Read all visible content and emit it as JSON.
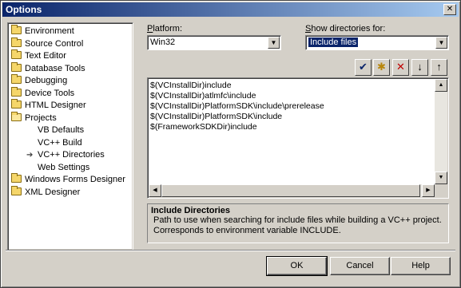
{
  "window": {
    "title": "Options",
    "close_glyph": "✕"
  },
  "tree": {
    "items": [
      {
        "label": "Environment",
        "icon": "folder-icon"
      },
      {
        "label": "Source Control",
        "icon": "folder-icon"
      },
      {
        "label": "Text Editor",
        "icon": "folder-icon"
      },
      {
        "label": "Database Tools",
        "icon": "folder-icon"
      },
      {
        "label": "Debugging",
        "icon": "folder-icon"
      },
      {
        "label": "Device Tools",
        "icon": "folder-icon"
      },
      {
        "label": "HTML Designer",
        "icon": "folder-icon"
      },
      {
        "label": "Projects",
        "icon": "folder-open-icon"
      },
      {
        "label": "VB Defaults",
        "icon": "none"
      },
      {
        "label": "VC++ Build",
        "icon": "none"
      },
      {
        "label": "VC++ Directories",
        "icon": "selected-arrow-icon"
      },
      {
        "label": "Web Settings",
        "icon": "none"
      },
      {
        "label": "Windows Forms Designer",
        "icon": "folder-icon"
      },
      {
        "label": "XML Designer",
        "icon": "folder-icon"
      }
    ]
  },
  "platform": {
    "label_prefix": "",
    "label_underlined": "P",
    "label_rest": "latform:",
    "value": "Win32"
  },
  "show_dirs": {
    "label_prefix": "",
    "label_underlined": "S",
    "label_rest": "how directories for:",
    "value": "Include files"
  },
  "toolbar": {
    "check_glyph": "✔",
    "new_folder_glyph": "✱",
    "delete_glyph": "✕",
    "down_glyph": "↓",
    "up_glyph": "↑"
  },
  "directories": [
    "$(VCInstallDir)include",
    "$(VCInstallDir)atlmfc\\include",
    "$(VCInstallDir)PlatformSDK\\include\\prerelease",
    "$(VCInstallDir)PlatformSDK\\include",
    "$(FrameworkSDKDir)include"
  ],
  "description": {
    "title": "Include Directories",
    "line1": "Path to use when searching for include files while building a VC++ project.",
    "line2": "Corresponds to environment variable INCLUDE."
  },
  "buttons": {
    "ok": "OK",
    "cancel": "Cancel",
    "help": "Help"
  },
  "colors": {
    "title_bar": "#0a246a",
    "selection": "#0a246a",
    "face": "#d4d0c8"
  }
}
